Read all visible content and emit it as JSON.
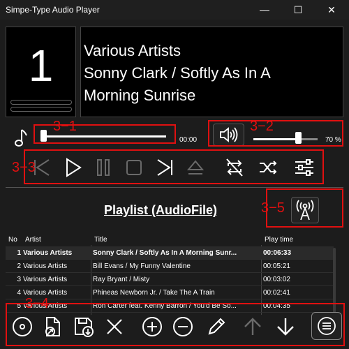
{
  "window": {
    "title": "Simpe-Type Audio Player",
    "minimize_glyph": "—",
    "maximize_glyph": "☐",
    "close_glyph": "✕"
  },
  "now_playing": {
    "track_number": "1",
    "lines": [
      "Various Artists",
      "Sonny Clark / Softly As In A",
      "Morning Sunrise"
    ]
  },
  "position": {
    "time_label": "00:00",
    "progress": 0.0
  },
  "volume": {
    "label": "70 %",
    "level": 0.7
  },
  "transport": {
    "buttons": [
      "previous-icon",
      "play-icon",
      "pause-icon",
      "stop-icon",
      "next-icon",
      "eject-icon",
      "repeat-icon",
      "shuffle-icon",
      "equalizer-icon"
    ]
  },
  "playlist": {
    "title": "Playlist (AudioFile)",
    "columns": [
      "No",
      "Artist",
      "Title",
      "Play time"
    ],
    "rows": [
      {
        "no": "1",
        "artist": "Various Artists",
        "title": "Sonny Clark / Softly As In A Morning Sunr...",
        "time": "00:06:33",
        "selected": true
      },
      {
        "no": "2",
        "artist": "Various Artists",
        "title": "Bill Evans / My Funny Valentine",
        "time": "00:05:21",
        "selected": false
      },
      {
        "no": "3",
        "artist": "Various Artists",
        "title": "Ray Bryant / Misty",
        "time": "00:03:02",
        "selected": false
      },
      {
        "no": "4",
        "artist": "Various Artists",
        "title": "Phineas Newborn Jr. / Take The A Train",
        "time": "00:02:41",
        "selected": false
      },
      {
        "no": "5",
        "artist": "Various Artists",
        "title": "Ron Carter feat. Kenny Barron / You'd Be So...",
        "time": "00:04:35",
        "selected": false
      }
    ]
  },
  "toolbar": {
    "buttons": [
      "disc-icon",
      "open-file-icon",
      "save-icon",
      "clear-icon",
      "add-icon",
      "remove-icon",
      "edit-icon",
      "move-up-icon",
      "move-down-icon",
      "menu-icon"
    ]
  },
  "annotations": {
    "label_3_1": "3−1",
    "label_3_2": "3−2",
    "label_3_3": "3−3",
    "label_3_4": "3−4",
    "label_3_5": "3−5",
    "color": "#e01010"
  },
  "colors": {
    "background": "#1c1c1c",
    "panel": "#000000",
    "text": "#ffffff",
    "disabled": "#6a6a6a"
  }
}
